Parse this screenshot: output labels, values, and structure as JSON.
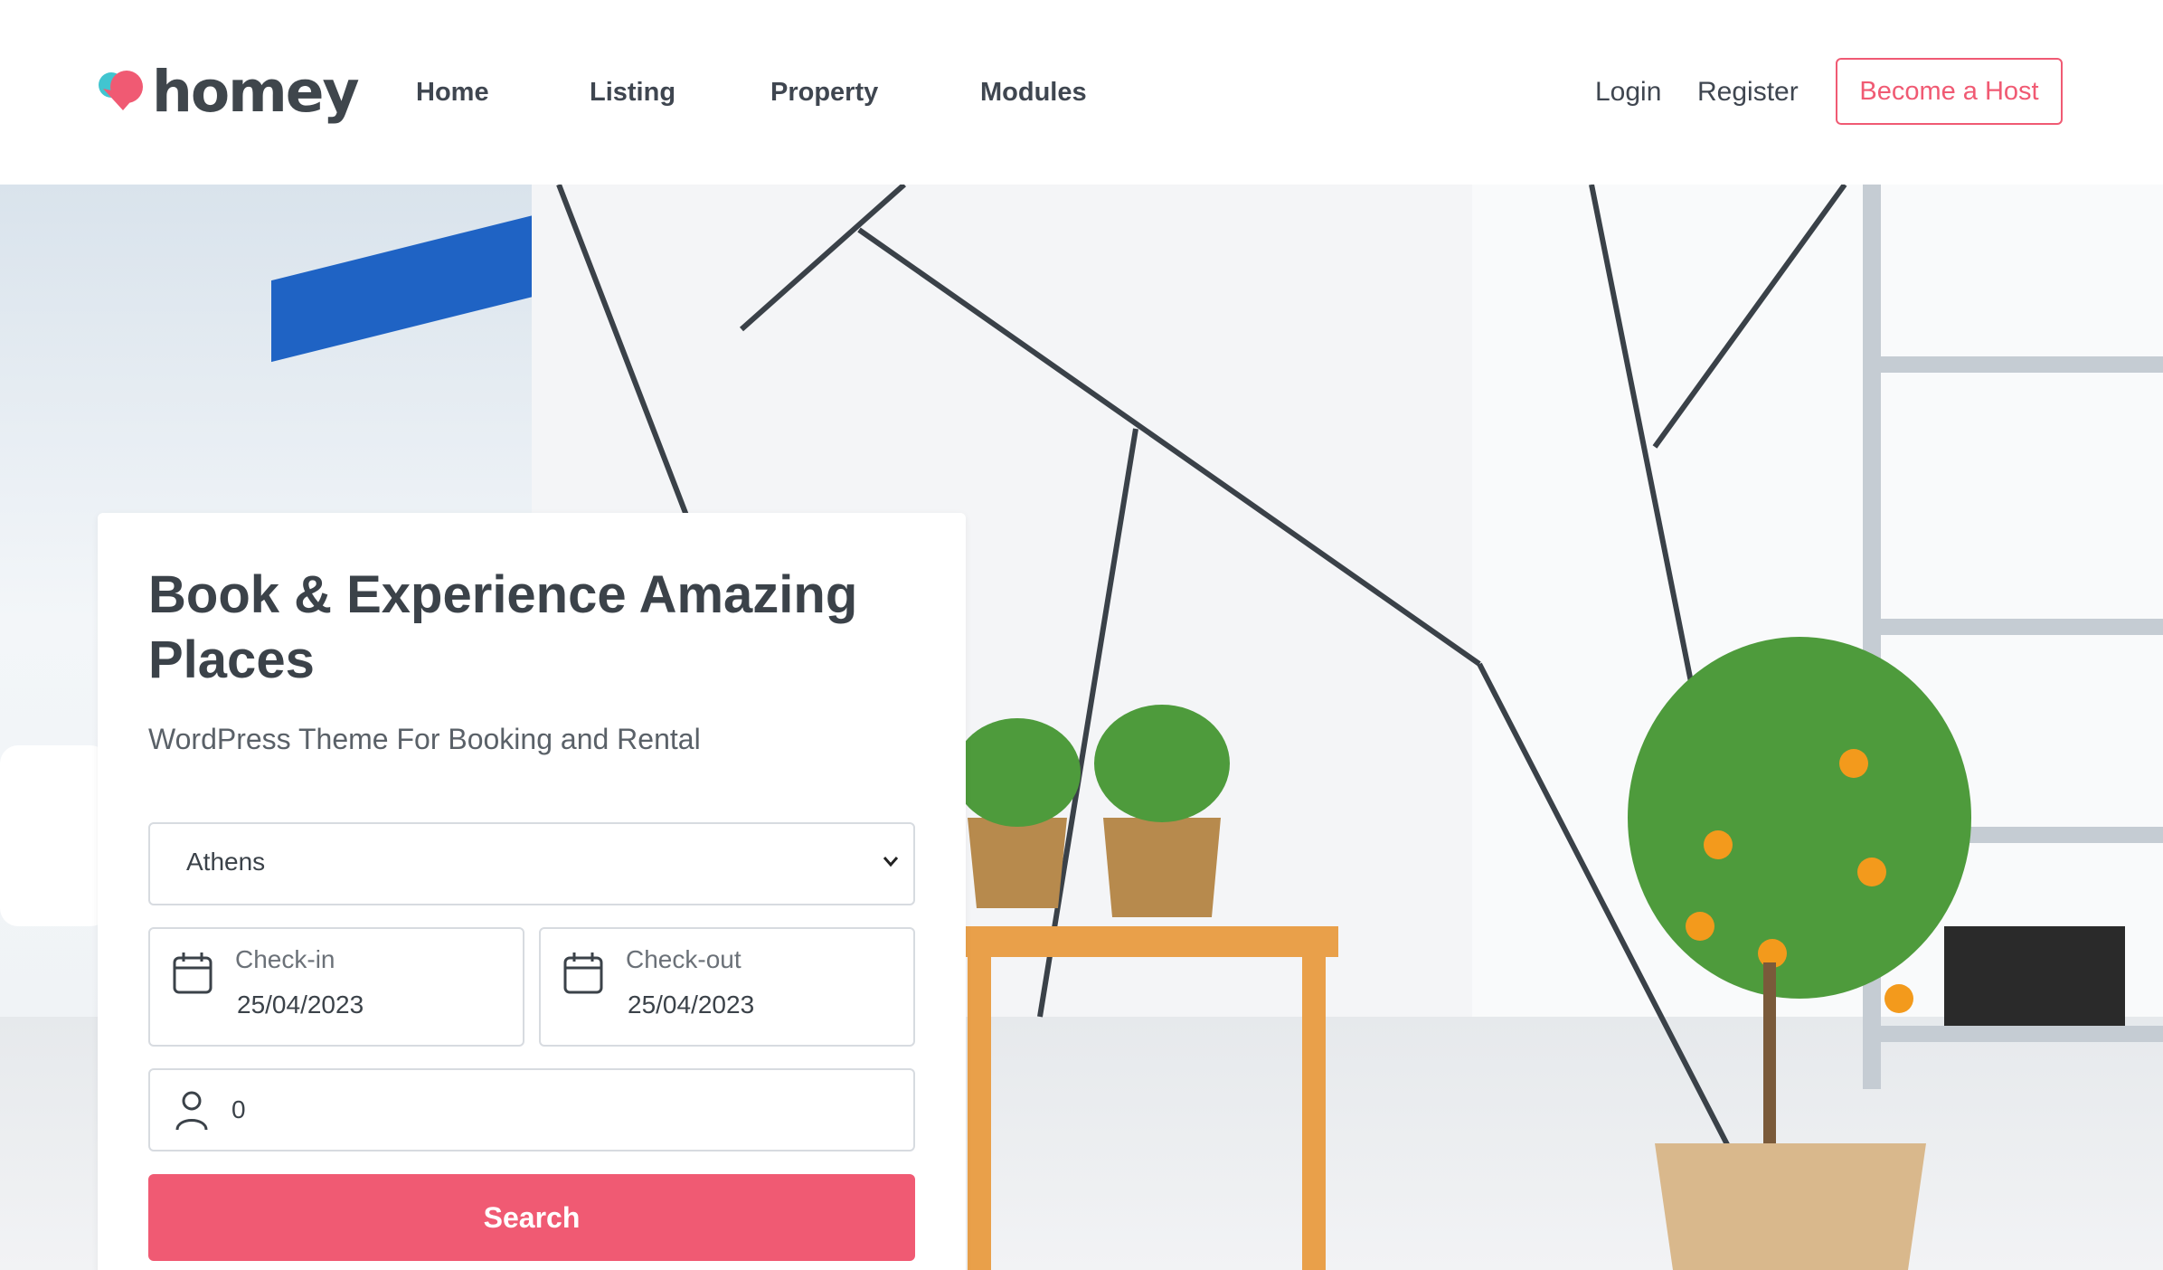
{
  "brand": {
    "name": "homey",
    "accent": "#f05a73",
    "logo_icon": "heart-logo-icon"
  },
  "nav": {
    "home": "Home",
    "listing": "Listing",
    "property": "Property",
    "modules": "Modules"
  },
  "auth": {
    "login": "Login",
    "register": "Register",
    "become_host": "Become a Host"
  },
  "search_card": {
    "title": "Book & Experience Amazing Places",
    "subtitle": "WordPress Theme For Booking and Rental",
    "city_value": "Athens",
    "checkin_label": "Check-in",
    "checkin_value": "25/04/2023",
    "checkout_label": "Check-out",
    "checkout_value": "25/04/2023",
    "guests_value": "0",
    "search_label": "Search"
  }
}
